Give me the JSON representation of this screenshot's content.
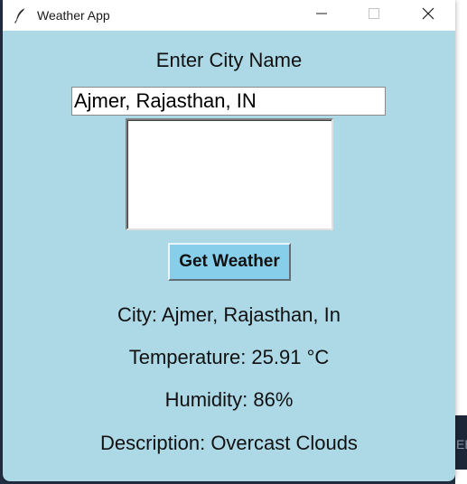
{
  "window": {
    "title": "Weather App",
    "app_icon": "feather-icon",
    "controls": {
      "minimize": "minimize-icon",
      "maximize": "maximize-icon",
      "close": "close-icon"
    }
  },
  "form": {
    "prompt": "Enter City Name",
    "city_value": "Ajmer, Rajasthan, IN",
    "button_label": "Get Weather"
  },
  "results": {
    "city": "City: Ajmer, Rajasthan, In",
    "temperature": "Temperature: 25.91 °C",
    "humidity": "Humidity: 86%",
    "description": "Description: Overcast Clouds"
  },
  "background": {
    "right_edge_text": "EB"
  },
  "colors": {
    "window_bg": "#add8e6",
    "button_bg": "#87ceeb",
    "titlebar_bg": "#ffffff"
  }
}
